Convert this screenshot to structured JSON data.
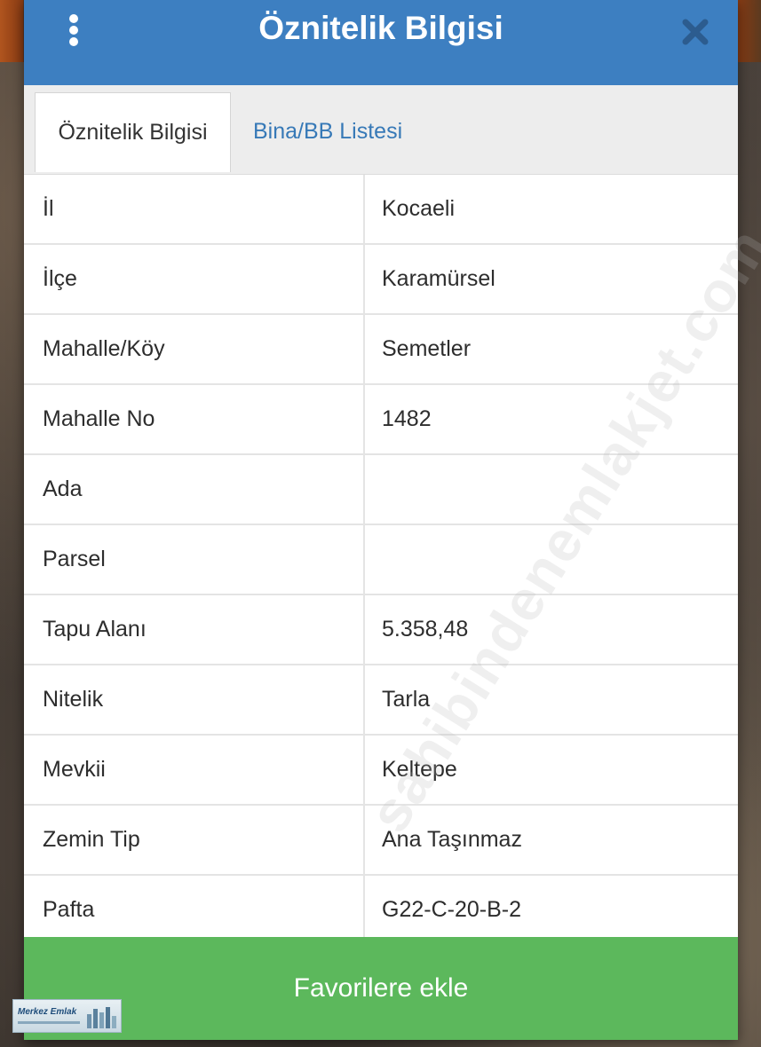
{
  "header": {
    "title": "Öznitelik Bilgisi"
  },
  "tabs": [
    {
      "label": "Öznitelik Bilgisi",
      "active": true
    },
    {
      "label": "Bina/BB Listesi",
      "active": false
    }
  ],
  "attributes": [
    {
      "key": "İl",
      "value": "Kocaeli"
    },
    {
      "key": "İlçe",
      "value": "Karamürsel"
    },
    {
      "key": "Mahalle/Köy",
      "value": "Semetler"
    },
    {
      "key": "Mahalle No",
      "value": "1482"
    },
    {
      "key": "Ada",
      "value": ""
    },
    {
      "key": "Parsel",
      "value": ""
    },
    {
      "key": "Tapu Alanı",
      "value": "5.358,48"
    },
    {
      "key": "Nitelik",
      "value": "Tarla"
    },
    {
      "key": "Mevkii",
      "value": "Keltepe"
    },
    {
      "key": "Zemin Tip",
      "value": "Ana Taşınmaz"
    },
    {
      "key": "Pafta",
      "value": "G22-C-20-B-2"
    }
  ],
  "favorite_button": {
    "label": "Favorilere ekle"
  },
  "watermark": {
    "text": "sahibindenemlakjet.com"
  },
  "logo": {
    "text": "Merkez Emlak"
  },
  "icons": {
    "menu": "more-vertical-icon",
    "close": "close-icon"
  },
  "colors": {
    "header": "#3d7fc1",
    "tab_link": "#3779b7",
    "button": "#5cb85c"
  }
}
